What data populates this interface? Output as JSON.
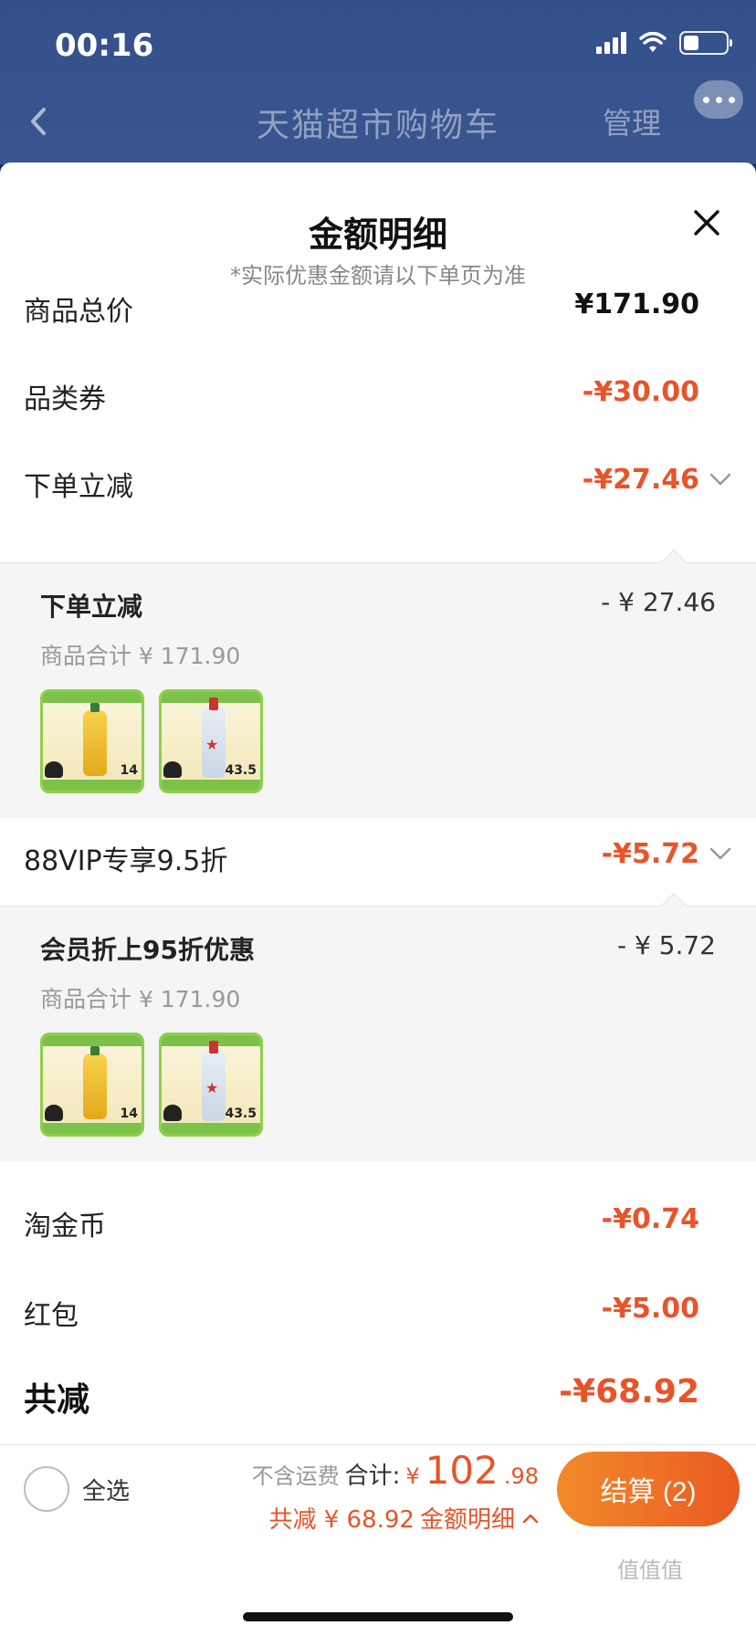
{
  "status_bar": {
    "time": "00:16",
    "battery_level": 0.36
  },
  "nav": {
    "title": "天猫超市购物车",
    "manage": "管理"
  },
  "sheet": {
    "title": "金额明细",
    "subtitle": "*实际优惠金额请以下单页为准",
    "rows": {
      "total_price": {
        "label": "商品总价",
        "value": "¥171.90"
      },
      "category_coupon": {
        "label": "品类券",
        "value": "-¥30.00"
      },
      "instant_discount": {
        "label": "下单立减",
        "value": "-¥27.46"
      },
      "vip": {
        "label": "88VIP专享9.5折",
        "value": "-¥5.72"
      },
      "taojinbi": {
        "label": "淘金币",
        "value": "-¥0.74"
      },
      "red_packet": {
        "label": "红包",
        "value": "-¥5.00"
      },
      "total_saved": {
        "label": "共减",
        "value": "-¥68.92"
      }
    },
    "panels": [
      {
        "title": "下单立减",
        "amount": "- ¥ 27.46",
        "subtotal": "商品合计 ¥ 171.90",
        "products": [
          {
            "kind": "oil",
            "price": "14"
          },
          {
            "kind": "baijiu",
            "price": "43.5"
          }
        ]
      },
      {
        "title": "会员折上95折优惠",
        "amount": "- ¥ 5.72",
        "subtotal": "商品合计 ¥ 171.90",
        "products": [
          {
            "kind": "oil",
            "price": "14"
          },
          {
            "kind": "baijiu",
            "price": "43.5"
          }
        ]
      }
    ]
  },
  "bottom": {
    "select_all": "全选",
    "no_shipping": "不含运费",
    "subtotal_label": "合计:",
    "yen": "¥",
    "price_int": "102",
    "price_dec": ".98",
    "saved_text": "共减 ¥ 68.92",
    "detail_link": "金额明细",
    "checkout": "结算 (2)"
  },
  "watermark": "值值值",
  "colors": {
    "accent": "#e8542a",
    "header_bg": "#3a5590",
    "panel_bg": "#f5f5f5"
  }
}
